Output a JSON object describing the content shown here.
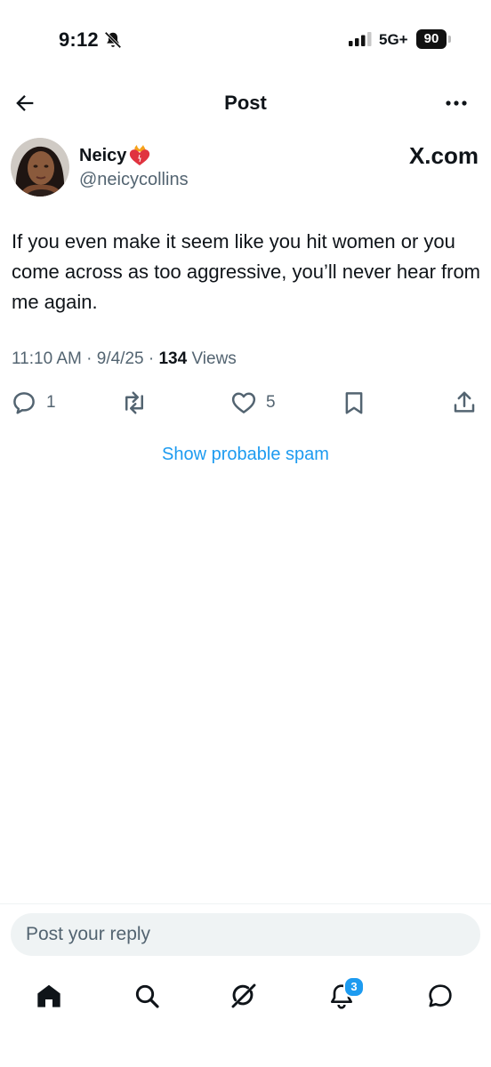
{
  "status_bar": {
    "time": "9:12",
    "network": "5G+",
    "battery": "90",
    "icons": [
      "bell-slash-icon",
      "signal-icon",
      "battery-icon"
    ]
  },
  "header": {
    "title": "Post",
    "icons": [
      "back-arrow-icon",
      "more-icon"
    ]
  },
  "post": {
    "author": {
      "display_name": "Neicy",
      "handle": "@neicycollins",
      "avatar": "avatar-photo",
      "name_emoji": "heart-on-fire-icon"
    },
    "watermark": "X.com",
    "text": "If you even make it seem like you hit women or you come across as too aggressive, you’ll never hear from me again.",
    "time": "11:10 AM",
    "date": "9/4/25",
    "views_count": "134",
    "views_label": "Views",
    "actions": {
      "reply_count": "1",
      "like_count": "5",
      "icons": [
        "reply-icon",
        "repost-icon",
        "like-icon",
        "bookmark-icon",
        "share-icon"
      ]
    }
  },
  "spam_link": "Show probable spam",
  "reply": {
    "placeholder": "Post your reply"
  },
  "tabbar": {
    "icons": [
      "home-icon",
      "search-icon",
      "grok-icon",
      "notifications-icon",
      "messages-icon"
    ],
    "notifications_badge": "3"
  },
  "colors": {
    "accent": "#1d9bf0",
    "text": "#0f1419",
    "secondary": "#536471"
  }
}
